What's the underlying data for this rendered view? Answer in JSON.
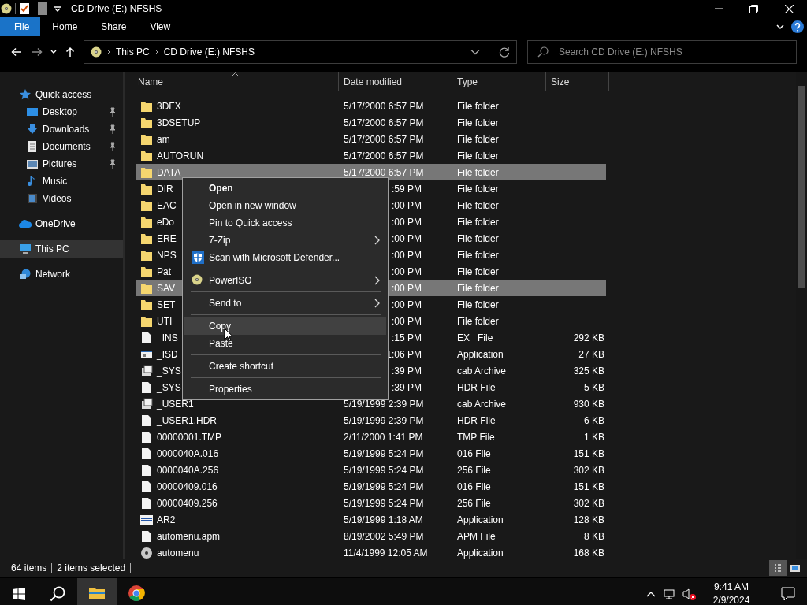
{
  "window": {
    "title": "CD Drive (E:) NFSHS"
  },
  "ribbon_tabs": [
    {
      "label": "File",
      "selected": true
    },
    {
      "label": "Home",
      "selected": false
    },
    {
      "label": "Share",
      "selected": false
    },
    {
      "label": "View",
      "selected": false
    }
  ],
  "address": {
    "segments": [
      "This PC",
      "CD Drive (E:) NFSHS"
    ]
  },
  "search": {
    "placeholder": "Search CD Drive (E:) NFSHS"
  },
  "sidebar": {
    "items": [
      {
        "label": "Quick access",
        "kind": "star",
        "selected": false,
        "children": [
          {
            "label": "Desktop",
            "kind": "desktop",
            "pinned": true
          },
          {
            "label": "Downloads",
            "kind": "download",
            "pinned": true
          },
          {
            "label": "Documents",
            "kind": "document",
            "pinned": true
          },
          {
            "label": "Pictures",
            "kind": "pictures",
            "pinned": true
          },
          {
            "label": "Music",
            "kind": "music",
            "pinned": false
          },
          {
            "label": "Videos",
            "kind": "videos",
            "pinned": false
          }
        ]
      },
      {
        "label": "OneDrive",
        "kind": "cloud",
        "selected": false
      },
      {
        "label": "This PC",
        "kind": "computer",
        "selected": true
      },
      {
        "label": "Network",
        "kind": "network",
        "selected": false
      }
    ]
  },
  "table": {
    "columns": [
      "Name",
      "Date modified",
      "Type",
      "Size"
    ],
    "rows": [
      {
        "name": "3DFX",
        "date": "5/17/2000 6:57 PM",
        "type": "File folder",
        "kind": "folder",
        "selected": false
      },
      {
        "name": "3DSETUP",
        "date": "5/17/2000 6:57 PM",
        "type": "File folder",
        "kind": "folder",
        "selected": false
      },
      {
        "name": "am",
        "date": "5/17/2000 6:57 PM",
        "type": "File folder",
        "kind": "folder",
        "selected": false
      },
      {
        "name": "AUTORUN",
        "date": "5/17/2000 6:57 PM",
        "type": "File folder",
        "kind": "folder",
        "selected": false
      },
      {
        "name": "DATA",
        "date": "5/17/2000 6:57 PM",
        "type": "File folder",
        "kind": "folder",
        "selected": true
      },
      {
        "name": "DIR",
        "date": ":59 PM",
        "type": "File folder",
        "kind": "folder",
        "selected": false
      },
      {
        "name": "EAC",
        "date": ":00 PM",
        "type": "File folder",
        "kind": "folder",
        "selected": false
      },
      {
        "name": "eDo",
        "date": ":00 PM",
        "type": "File folder",
        "kind": "folder",
        "selected": false
      },
      {
        "name": "ERE",
        "date": ":00 PM",
        "type": "File folder",
        "kind": "folder",
        "selected": false
      },
      {
        "name": "NPS",
        "date": ":00 PM",
        "type": "File folder",
        "kind": "folder",
        "selected": false
      },
      {
        "name": "Pat",
        "date": ":00 PM",
        "type": "File folder",
        "kind": "folder",
        "selected": false
      },
      {
        "name": "SAV",
        "date": ":00 PM",
        "type": "File folder",
        "kind": "folder",
        "selected": true
      },
      {
        "name": "SET",
        "date": ":00 PM",
        "type": "File folder",
        "kind": "folder",
        "selected": false
      },
      {
        "name": "UTI",
        "date": ":00 PM",
        "type": "File folder",
        "kind": "folder",
        "selected": false
      },
      {
        "name": "_INS",
        "date": ":15 PM",
        "type": "EX_ File",
        "size": "292 KB",
        "kind": "file",
        "selected": false
      },
      {
        "name": "_ISD",
        "date": "1:06 PM",
        "type": "Application",
        "size": "27 KB",
        "kind": "window",
        "selected": false
      },
      {
        "name": "_SYS",
        "date": ":39 PM",
        "type": "cab Archive",
        "size": "325 KB",
        "kind": "archive",
        "selected": false
      },
      {
        "name": "_SYS",
        "date": ":39 PM",
        "type": "HDR File",
        "size": "5 KB",
        "kind": "file",
        "selected": false
      },
      {
        "name": "_USER1",
        "date": "5/19/1999 2:39 PM",
        "type": "cab Archive",
        "size": "930 KB",
        "kind": "archive",
        "selected": false
      },
      {
        "name": "_USER1.HDR",
        "date": "5/19/1999 2:39 PM",
        "type": "HDR File",
        "size": "6 KB",
        "kind": "file",
        "selected": false
      },
      {
        "name": "00000001.TMP",
        "date": "2/11/2000 1:41 PM",
        "type": "TMP File",
        "size": "1 KB",
        "kind": "file",
        "selected": false
      },
      {
        "name": "0000040A.016",
        "date": "5/19/1999 5:24 PM",
        "type": "016 File",
        "size": "151 KB",
        "kind": "file",
        "selected": false
      },
      {
        "name": "0000040A.256",
        "date": "5/19/1999 5:24 PM",
        "type": "256 File",
        "size": "302 KB",
        "kind": "file",
        "selected": false
      },
      {
        "name": "00000409.016",
        "date": "5/19/1999 5:24 PM",
        "type": "016 File",
        "size": "151 KB",
        "kind": "file",
        "selected": false
      },
      {
        "name": "00000409.256",
        "date": "5/19/1999 5:24 PM",
        "type": "256 File",
        "size": "302 KB",
        "kind": "file",
        "selected": false
      },
      {
        "name": "AR2",
        "date": "5/19/1999 1:18 AM",
        "type": "Application",
        "size": "128 KB",
        "kind": "banner",
        "selected": false
      },
      {
        "name": "automenu.apm",
        "date": "8/19/2002 5:49 PM",
        "type": "APM File",
        "size": "8 KB",
        "kind": "file",
        "selected": false
      },
      {
        "name": "automenu",
        "date": "11/4/1999 12:05 AM",
        "type": "Application",
        "size": "168 KB",
        "kind": "disc",
        "selected": false
      }
    ]
  },
  "context_menu": {
    "groups": [
      [
        {
          "label": "Open",
          "default": true,
          "submenu": false,
          "highlighted": false
        },
        {
          "label": "Open in new window",
          "default": false,
          "submenu": false,
          "highlighted": false
        },
        {
          "label": "Pin to Quick access",
          "default": false,
          "submenu": false,
          "highlighted": false
        },
        {
          "label": "7-Zip",
          "default": false,
          "submenu": true,
          "highlighted": false
        },
        {
          "label": "Scan with Microsoft Defender...",
          "kind": "shield",
          "default": false,
          "submenu": false,
          "highlighted": false
        }
      ],
      [
        {
          "label": "PowerISO",
          "kind": "disc",
          "default": false,
          "submenu": true,
          "highlighted": false
        }
      ],
      [
        {
          "label": "Send to",
          "default": false,
          "submenu": true,
          "highlighted": false
        }
      ],
      [
        {
          "label": "Copy",
          "default": false,
          "submenu": false,
          "highlighted": true
        },
        {
          "label": "Paste",
          "default": false,
          "submenu": false,
          "highlighted": false
        }
      ],
      [
        {
          "label": "Create shortcut",
          "default": false,
          "submenu": false,
          "highlighted": false
        }
      ],
      [
        {
          "label": "Properties",
          "default": false,
          "submenu": false,
          "highlighted": false
        }
      ]
    ]
  },
  "status_bar": {
    "item_count": "64 items",
    "selection": "2 items selected",
    "views": [
      {
        "kind": "details",
        "selected": true
      },
      {
        "kind": "large-icons",
        "selected": false
      }
    ]
  },
  "taskbar": {
    "apps": [
      {
        "kind": "explorer",
        "selected": true
      },
      {
        "kind": "chrome",
        "selected": false
      }
    ],
    "time": "9:41 AM",
    "date": "2/9/2024",
    "volume_muted": true
  }
}
